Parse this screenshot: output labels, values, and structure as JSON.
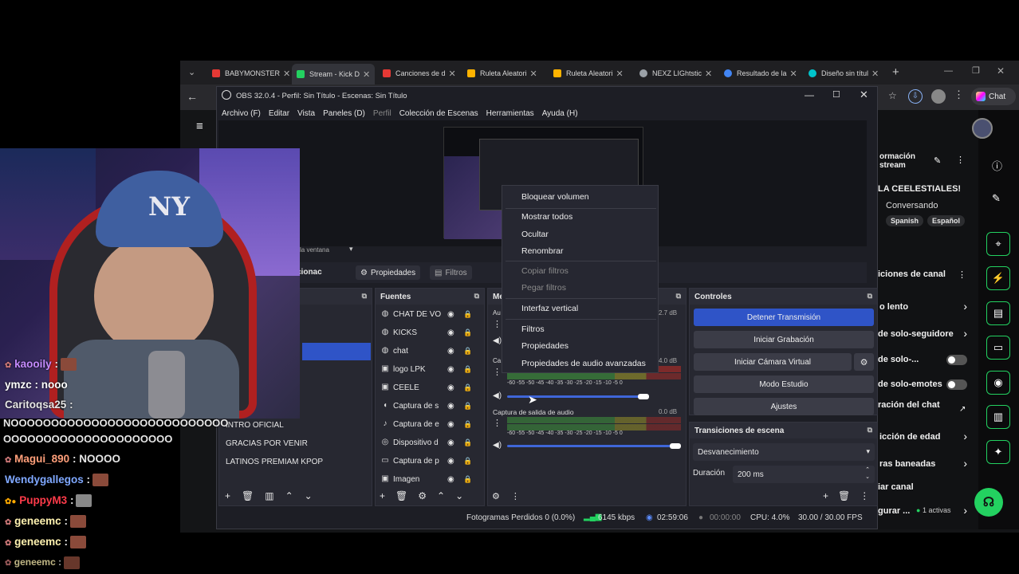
{
  "browser": {
    "tabs": [
      {
        "label": "BABYMONSTER",
        "color": "#e53935"
      },
      {
        "label": "Stream - Kick D",
        "color": "#23d160"
      },
      {
        "label": "Canciones de d",
        "color": "#e53935"
      },
      {
        "label": "Ruleta Aleatori",
        "color": "#ffb300"
      },
      {
        "label": "Ruleta Aleatori",
        "color": "#ffb300"
      },
      {
        "label": "NEXZ LIGhtstic",
        "color": "#9aa0a6"
      },
      {
        "label": "Resultado de la",
        "color": "#4285f4"
      },
      {
        "label": "Diseño sin títul",
        "color": "#00c4cc"
      }
    ],
    "chat_button": "Chat"
  },
  "obs": {
    "title": "OBS 32.0.4 - Perfil: Sin Título - Escenas: Sin Título",
    "menu": [
      "Archivo (F)",
      "Editar",
      "Vista",
      "Paneles (D)",
      "Perfil",
      "Colección de Escenas",
      "Herramientas",
      "Ayuda (H)"
    ],
    "window_label": "la ventana",
    "toolbar": {
      "section_label": "cionac",
      "properties": "Propiedades",
      "filters": "Filtros"
    },
    "scenes": [
      "INTRO OFICIAL",
      "GRACIAS POR VENIR",
      "LATINOS PREMIAM KPOP"
    ],
    "sources_title": "Fuentes",
    "sources": [
      {
        "name": "CHAT DE VOZ",
        "icon": "globe-icon"
      },
      {
        "name": "KICKS",
        "icon": "globe-icon"
      },
      {
        "name": "chat",
        "icon": "globe-icon"
      },
      {
        "name": "logo LPK",
        "icon": "image-icon"
      },
      {
        "name": "CEELE",
        "icon": "image-icon"
      },
      {
        "name": "Captura de s",
        "icon": "speaker-icon"
      },
      {
        "name": "Captura de e",
        "icon": "mic-icon"
      },
      {
        "name": "Dispositivo d",
        "icon": "camera-icon"
      },
      {
        "name": "Captura de p",
        "icon": "monitor-icon"
      },
      {
        "name": "Imagen",
        "icon": "image-icon"
      }
    ],
    "mixer": {
      "title": "Me",
      "ch1_label": "Au",
      "ch1_db": "2.7 dB",
      "ch2_label": "Ca",
      "ch2_db": "4.0 dB",
      "ch3_label": "Captura de salida de audio",
      "ch3_db": "0.0 dB",
      "scale": "-60 -55 -50 -45 -40 -35 -30 -25 -20 -15 -10 -5 0"
    },
    "controls": {
      "title": "Controles",
      "stop_stream": "Detener Transmisión",
      "start_recording": "Iniciar Grabación",
      "start_virtual_cam": "Iniciar Cámara Virtual",
      "studio_mode": "Modo Estudio",
      "settings": "Ajustes"
    },
    "transitions": {
      "title": "Transiciones de escena",
      "selected": "Desvanecimiento",
      "duration_label": "Duración",
      "duration_value": "200 ms"
    },
    "status": {
      "dropped": "Fotogramas Perdidos 0 (0.0%)",
      "bitrate": "6145 kbps",
      "stream_time": "02:59:06",
      "rec_time": "00:00:00",
      "cpu": "CPU: 4.0%",
      "fps": "30.00 / 30.00 FPS"
    },
    "context_menu": {
      "lock_volume": "Bloquear volumen",
      "show_all": "Mostrar todos",
      "hide": "Ocultar",
      "rename": "Renombrar",
      "copy_filters": "Copiar filtros",
      "paste_filters": "Pegar filtros",
      "vertical_interface": "Interfaz vertical",
      "filters": "Filtros",
      "properties": "Propiedades",
      "advanced_audio": "Propiedades de audio avanzadas"
    }
  },
  "kick": {
    "stream_info_1": "ormación",
    "stream_info_2": "stream",
    "title": "LA CEELESTIALES!",
    "category": "Conversando",
    "tag1": "Spanish",
    "tag2": "Español",
    "channel_actions": "iciones de canal",
    "slow": "o lento",
    "followers": "de solo-seguidore",
    "subs": "de solo-...",
    "emotes": "de solo-emotes",
    "chat_dur": "ración del chat",
    "age": "icción de edad",
    "banned": "ras baneadas",
    "clear": "iar canal",
    "config": "gurar ...",
    "active": "1 activas"
  },
  "chat": {
    "messages": [
      {
        "user": "kaooily",
        "text": ":",
        "color": "#c58bff"
      },
      {
        "user": "ymzc",
        "text": ": nooo",
        "color": "#ffffff"
      },
      {
        "user": "Caritoqsa25",
        "text": ":",
        "color": "#f2f2f2"
      },
      {
        "user": "",
        "text": "NOOOOOOOOOOOOOOOOOOOOOOOOOOO",
        "color": "#ffffff"
      },
      {
        "user": "",
        "text": "OOOOOOOOOOOOOOOOOOOOO",
        "color": "#ffffff"
      },
      {
        "user": "Magui_890",
        "text": ": NOOOO",
        "color": "#ff9f7a"
      },
      {
        "user": "Wendygallegos",
        "text": ":",
        "color": "#7fa8ff"
      },
      {
        "user": "PuppyM3",
        "text": ":",
        "color": "#ff3b4a"
      },
      {
        "user": "geneemc",
        "text": ":",
        "color": "#fff2b0"
      },
      {
        "user": "geneemc",
        "text": ":",
        "color": "#fff2b0"
      },
      {
        "user": "geneemc",
        "text": ":",
        "color": "#fff2b0"
      }
    ]
  }
}
